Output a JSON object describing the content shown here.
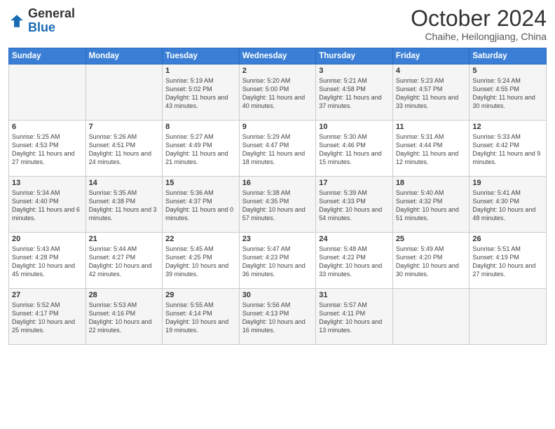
{
  "header": {
    "logo_general": "General",
    "logo_blue": "Blue",
    "month_title": "October 2024",
    "location": "Chaihe, Heilongjiang, China"
  },
  "weekdays": [
    "Sunday",
    "Monday",
    "Tuesday",
    "Wednesday",
    "Thursday",
    "Friday",
    "Saturday"
  ],
  "weeks": [
    [
      {
        "day": "",
        "sunrise": "",
        "sunset": "",
        "daylight": ""
      },
      {
        "day": "",
        "sunrise": "",
        "sunset": "",
        "daylight": ""
      },
      {
        "day": "1",
        "sunrise": "Sunrise: 5:19 AM",
        "sunset": "Sunset: 5:02 PM",
        "daylight": "Daylight: 11 hours and 43 minutes."
      },
      {
        "day": "2",
        "sunrise": "Sunrise: 5:20 AM",
        "sunset": "Sunset: 5:00 PM",
        "daylight": "Daylight: 11 hours and 40 minutes."
      },
      {
        "day": "3",
        "sunrise": "Sunrise: 5:21 AM",
        "sunset": "Sunset: 4:58 PM",
        "daylight": "Daylight: 11 hours and 37 minutes."
      },
      {
        "day": "4",
        "sunrise": "Sunrise: 5:23 AM",
        "sunset": "Sunset: 4:57 PM",
        "daylight": "Daylight: 11 hours and 33 minutes."
      },
      {
        "day": "5",
        "sunrise": "Sunrise: 5:24 AM",
        "sunset": "Sunset: 4:55 PM",
        "daylight": "Daylight: 11 hours and 30 minutes."
      }
    ],
    [
      {
        "day": "6",
        "sunrise": "Sunrise: 5:25 AM",
        "sunset": "Sunset: 4:53 PM",
        "daylight": "Daylight: 11 hours and 27 minutes."
      },
      {
        "day": "7",
        "sunrise": "Sunrise: 5:26 AM",
        "sunset": "Sunset: 4:51 PM",
        "daylight": "Daylight: 11 hours and 24 minutes."
      },
      {
        "day": "8",
        "sunrise": "Sunrise: 5:27 AM",
        "sunset": "Sunset: 4:49 PM",
        "daylight": "Daylight: 11 hours and 21 minutes."
      },
      {
        "day": "9",
        "sunrise": "Sunrise: 5:29 AM",
        "sunset": "Sunset: 4:47 PM",
        "daylight": "Daylight: 11 hours and 18 minutes."
      },
      {
        "day": "10",
        "sunrise": "Sunrise: 5:30 AM",
        "sunset": "Sunset: 4:46 PM",
        "daylight": "Daylight: 11 hours and 15 minutes."
      },
      {
        "day": "11",
        "sunrise": "Sunrise: 5:31 AM",
        "sunset": "Sunset: 4:44 PM",
        "daylight": "Daylight: 11 hours and 12 minutes."
      },
      {
        "day": "12",
        "sunrise": "Sunrise: 5:33 AM",
        "sunset": "Sunset: 4:42 PM",
        "daylight": "Daylight: 11 hours and 9 minutes."
      }
    ],
    [
      {
        "day": "13",
        "sunrise": "Sunrise: 5:34 AM",
        "sunset": "Sunset: 4:40 PM",
        "daylight": "Daylight: 11 hours and 6 minutes."
      },
      {
        "day": "14",
        "sunrise": "Sunrise: 5:35 AM",
        "sunset": "Sunset: 4:38 PM",
        "daylight": "Daylight: 11 hours and 3 minutes."
      },
      {
        "day": "15",
        "sunrise": "Sunrise: 5:36 AM",
        "sunset": "Sunset: 4:37 PM",
        "daylight": "Daylight: 11 hours and 0 minutes."
      },
      {
        "day": "16",
        "sunrise": "Sunrise: 5:38 AM",
        "sunset": "Sunset: 4:35 PM",
        "daylight": "Daylight: 10 hours and 57 minutes."
      },
      {
        "day": "17",
        "sunrise": "Sunrise: 5:39 AM",
        "sunset": "Sunset: 4:33 PM",
        "daylight": "Daylight: 10 hours and 54 minutes."
      },
      {
        "day": "18",
        "sunrise": "Sunrise: 5:40 AM",
        "sunset": "Sunset: 4:32 PM",
        "daylight": "Daylight: 10 hours and 51 minutes."
      },
      {
        "day": "19",
        "sunrise": "Sunrise: 5:41 AM",
        "sunset": "Sunset: 4:30 PM",
        "daylight": "Daylight: 10 hours and 48 minutes."
      }
    ],
    [
      {
        "day": "20",
        "sunrise": "Sunrise: 5:43 AM",
        "sunset": "Sunset: 4:28 PM",
        "daylight": "Daylight: 10 hours and 45 minutes."
      },
      {
        "day": "21",
        "sunrise": "Sunrise: 5:44 AM",
        "sunset": "Sunset: 4:27 PM",
        "daylight": "Daylight: 10 hours and 42 minutes."
      },
      {
        "day": "22",
        "sunrise": "Sunrise: 5:45 AM",
        "sunset": "Sunset: 4:25 PM",
        "daylight": "Daylight: 10 hours and 39 minutes."
      },
      {
        "day": "23",
        "sunrise": "Sunrise: 5:47 AM",
        "sunset": "Sunset: 4:23 PM",
        "daylight": "Daylight: 10 hours and 36 minutes."
      },
      {
        "day": "24",
        "sunrise": "Sunrise: 5:48 AM",
        "sunset": "Sunset: 4:22 PM",
        "daylight": "Daylight: 10 hours and 33 minutes."
      },
      {
        "day": "25",
        "sunrise": "Sunrise: 5:49 AM",
        "sunset": "Sunset: 4:20 PM",
        "daylight": "Daylight: 10 hours and 30 minutes."
      },
      {
        "day": "26",
        "sunrise": "Sunrise: 5:51 AM",
        "sunset": "Sunset: 4:19 PM",
        "daylight": "Daylight: 10 hours and 27 minutes."
      }
    ],
    [
      {
        "day": "27",
        "sunrise": "Sunrise: 5:52 AM",
        "sunset": "Sunset: 4:17 PM",
        "daylight": "Daylight: 10 hours and 25 minutes."
      },
      {
        "day": "28",
        "sunrise": "Sunrise: 5:53 AM",
        "sunset": "Sunset: 4:16 PM",
        "daylight": "Daylight: 10 hours and 22 minutes."
      },
      {
        "day": "29",
        "sunrise": "Sunrise: 5:55 AM",
        "sunset": "Sunset: 4:14 PM",
        "daylight": "Daylight: 10 hours and 19 minutes."
      },
      {
        "day": "30",
        "sunrise": "Sunrise: 5:56 AM",
        "sunset": "Sunset: 4:13 PM",
        "daylight": "Daylight: 10 hours and 16 minutes."
      },
      {
        "day": "31",
        "sunrise": "Sunrise: 5:57 AM",
        "sunset": "Sunset: 4:11 PM",
        "daylight": "Daylight: 10 hours and 13 minutes."
      },
      {
        "day": "",
        "sunrise": "",
        "sunset": "",
        "daylight": ""
      },
      {
        "day": "",
        "sunrise": "",
        "sunset": "",
        "daylight": ""
      }
    ]
  ]
}
